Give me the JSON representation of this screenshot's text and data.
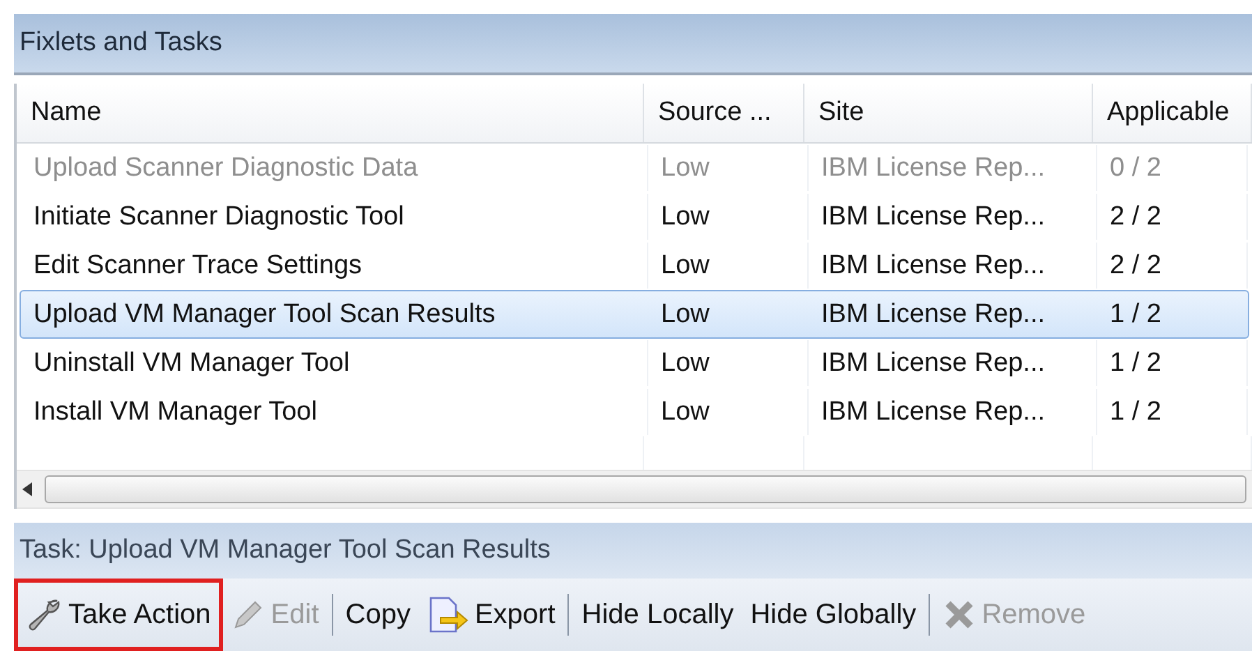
{
  "panel": {
    "title": "Fixlets and Tasks"
  },
  "table": {
    "columns": [
      "Name",
      "Source ...",
      "Site",
      "Applicable"
    ],
    "rows": [
      {
        "cells": [
          "Upload Scanner Diagnostic Data",
          "Low",
          "IBM License Rep...",
          "0 / 2"
        ],
        "disabled": true,
        "selected": false
      },
      {
        "cells": [
          "Initiate Scanner Diagnostic Tool",
          "Low",
          "IBM License Rep...",
          "2 / 2"
        ],
        "disabled": false,
        "selected": false
      },
      {
        "cells": [
          "Edit Scanner Trace Settings",
          "Low",
          "IBM License Rep...",
          "2 / 2"
        ],
        "disabled": false,
        "selected": false
      },
      {
        "cells": [
          "Upload VM Manager Tool Scan Results",
          "Low",
          "IBM License Rep...",
          "1 / 2"
        ],
        "disabled": false,
        "selected": true
      },
      {
        "cells": [
          "Uninstall VM Manager Tool",
          "Low",
          "IBM License Rep...",
          "1 / 2"
        ],
        "disabled": false,
        "selected": false
      },
      {
        "cells": [
          "Install VM Manager Tool",
          "Low",
          "IBM License Rep...",
          "1 / 2"
        ],
        "disabled": false,
        "selected": false
      }
    ]
  },
  "detail": {
    "title": "Task: Upload VM Manager Tool Scan Results"
  },
  "toolbar": [
    {
      "kind": "button",
      "label": "Take Action",
      "disabled": false,
      "highlighted": true
    },
    {
      "kind": "button",
      "label": "Edit",
      "disabled": true,
      "highlighted": false
    },
    {
      "kind": "separator"
    },
    {
      "kind": "button",
      "label": "Copy",
      "disabled": false,
      "highlighted": false
    },
    {
      "kind": "button",
      "label": "Export",
      "disabled": false,
      "highlighted": false
    },
    {
      "kind": "separator"
    },
    {
      "kind": "button",
      "label": "Hide Locally",
      "disabled": false,
      "highlighted": false
    },
    {
      "kind": "button",
      "label": "Hide Globally",
      "disabled": false,
      "highlighted": false
    },
    {
      "kind": "separator"
    },
    {
      "kind": "button",
      "label": "Remove",
      "disabled": true,
      "highlighted": false
    }
  ]
}
